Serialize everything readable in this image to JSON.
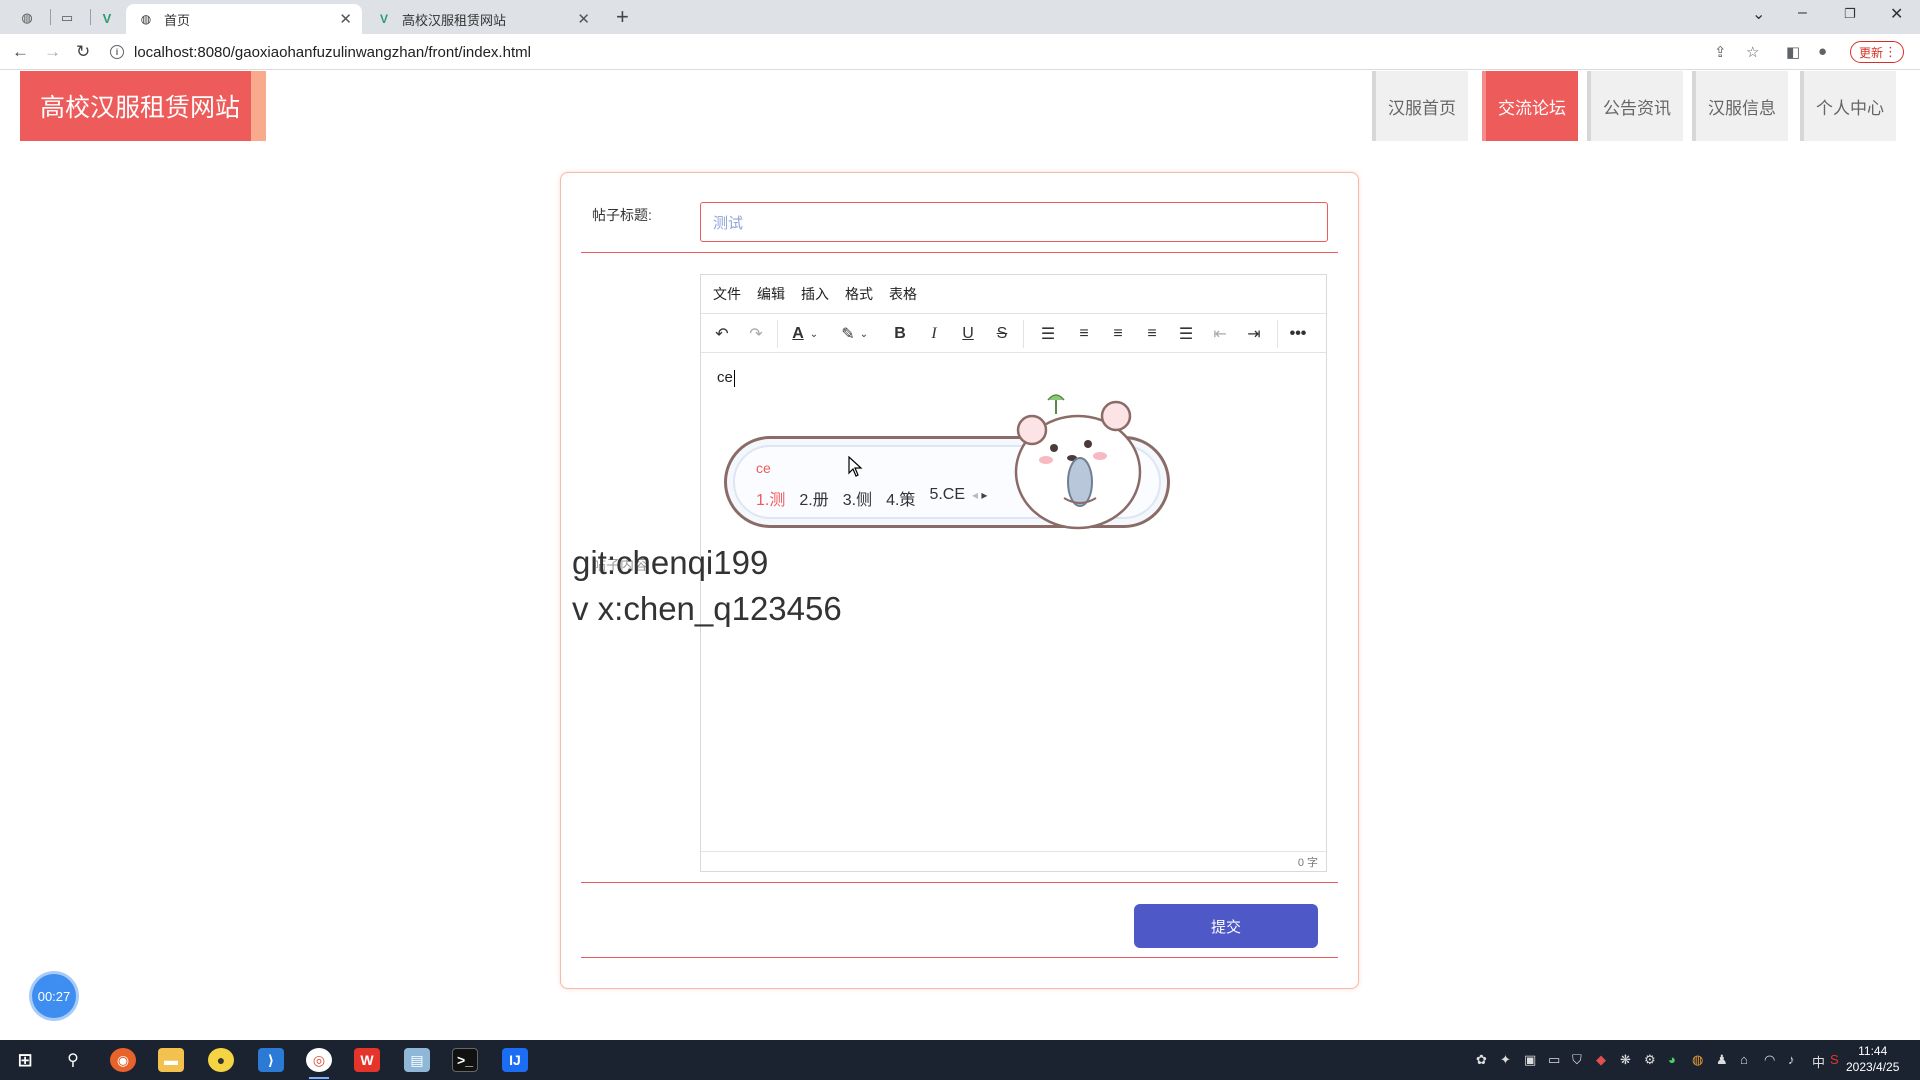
{
  "browser": {
    "tabs": [
      {
        "label": "首页",
        "active": true
      },
      {
        "label": "高校汉服租赁网站",
        "active": false
      }
    ],
    "url": "localhost:8080/gaoxiaohanfuzulinwangzhan/front/index.html",
    "update_label": "更新"
  },
  "site": {
    "logo": "高校汉服租赁网站",
    "nav": [
      {
        "label": "汉服首页",
        "active": false
      },
      {
        "label": "交流论坛",
        "active": true
      },
      {
        "label": "公告资讯",
        "active": false
      },
      {
        "label": "汉服信息",
        "active": false
      },
      {
        "label": "个人中心",
        "active": false
      }
    ]
  },
  "form": {
    "title_label": "帖子标题:",
    "title_value": "测试",
    "content_label": "帖子内容",
    "submit_label": "提交"
  },
  "editor": {
    "menus": [
      "文件",
      "编辑",
      "插入",
      "格式",
      "表格"
    ],
    "typed_text": "ce",
    "word_count": "0 字",
    "toolbar_icons": [
      "undo-icon",
      "redo-icon",
      "text-color-icon",
      "highlight-icon",
      "bold-icon",
      "italic-icon",
      "underline-icon",
      "strikethrough-icon",
      "line-height-icon",
      "align-left-icon",
      "align-center-icon",
      "align-right-icon",
      "justify-icon",
      "outdent-icon",
      "indent-icon",
      "more-icon"
    ]
  },
  "ime": {
    "composition": "ce",
    "candidates": [
      "1.测",
      "2.册",
      "3.侧",
      "4.策",
      "5.CE"
    ]
  },
  "watermark": {
    "line1": "git:chenqi199",
    "line2": "v x:chen_q123456"
  },
  "timer": "00:27",
  "taskbar": {
    "time": "11:44",
    "date": "2023/4/25",
    "ime_lang": "中"
  },
  "colors": {
    "accent_red": "#ee5b5b",
    "submit_blue": "#4e58c7",
    "taskbar": "#1b2330"
  }
}
